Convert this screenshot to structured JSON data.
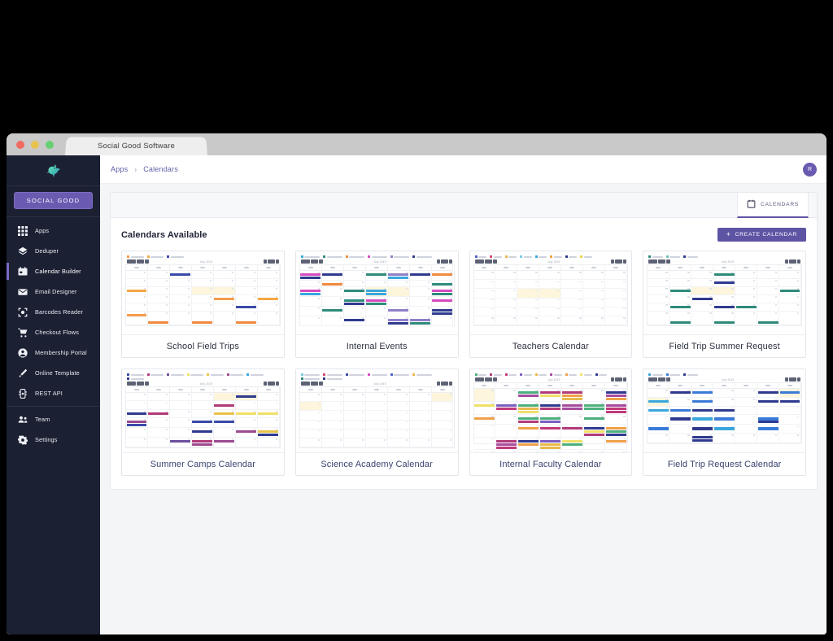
{
  "window": {
    "tab_title": "Social Good Software",
    "traffic_lights": [
      "close",
      "minimize",
      "maximize"
    ]
  },
  "sidebar": {
    "brand_label": "SOCIAL GOOD",
    "logo_icon": "hummingbird-logo",
    "groups": [
      {
        "items": [
          {
            "label": "Apps",
            "icon": "grid-icon",
            "active": false
          },
          {
            "label": "Deduper",
            "icon": "layers-icon",
            "active": false
          },
          {
            "label": "Calendar Builder",
            "icon": "calendar-icon",
            "active": true
          },
          {
            "label": "Email Designer",
            "icon": "envelope-icon",
            "active": false
          },
          {
            "label": "Barcodes Reader",
            "icon": "barcode-scan-icon",
            "active": false
          },
          {
            "label": "Checkout Flows",
            "icon": "shopping-cart-icon",
            "active": false
          },
          {
            "label": "Membership Portal",
            "icon": "user-circle-icon",
            "active": false
          },
          {
            "label": "Online Template",
            "icon": "pen-brush-icon",
            "active": false
          },
          {
            "label": "REST API",
            "icon": "api-plug-icon",
            "active": false
          }
        ]
      },
      {
        "items": [
          {
            "label": "Team",
            "icon": "users-icon",
            "active": false
          },
          {
            "label": "Settings",
            "icon": "gear-icon",
            "active": false
          }
        ]
      }
    ]
  },
  "topbar": {
    "breadcrumb": [
      "Apps",
      "Calendars"
    ],
    "separator": "›",
    "avatar_initial": "R"
  },
  "panel": {
    "tabs": [
      {
        "label": "CALENDARS",
        "icon": "calendar-icon",
        "active": true
      }
    ],
    "title": "Calendars Available",
    "create_button": {
      "label": "CREATE CALENDAR",
      "plus": "+"
    }
  },
  "calendars": [
    {
      "name": "School Field Trips",
      "row": 1,
      "legend_colors": [
        "#f59b4a",
        "#f5a742",
        "#3a4aa8"
      ],
      "accent": "#f08a3c",
      "month_label": "July 2019",
      "density": "low"
    },
    {
      "name": "Internal Events",
      "row": 1,
      "legend_colors": [
        "#3aa6dd",
        "#2e8b7a",
        "#f08a3c",
        "#d64bbf",
        "#8f7fc9",
        "#2f3a8f"
      ],
      "accent": "#2e8b7a",
      "month_label": "July 2019",
      "density": "high"
    },
    {
      "name": "Teachers Calendar",
      "row": 1,
      "legend_colors": [
        "#4c5fc2",
        "#d8456f",
        "#e8b84b",
        "#7ec8e3",
        "#3aa6dd",
        "#f2a03c",
        "#2f3a8f",
        "#e8d44b"
      ],
      "accent": "#9aa3bb",
      "month_label": "July 2019",
      "density": "none"
    },
    {
      "name": "Field Trip Summer Request",
      "row": 1,
      "legend_colors": [
        "#2e8b7a",
        "#6fc0b2",
        "#2f3a8f"
      ],
      "accent": "#2e8b7a",
      "month_label": "July 2019",
      "density": "low"
    },
    {
      "name": "Summer Camps Calendar",
      "row": 2,
      "legend_colors": [
        "#3a4aa8",
        "#b23a7a",
        "#6b4f9e",
        "#efe06a",
        "#e8c24b",
        "#9b4a8f",
        "#3aa6dd",
        "#2f3a8f"
      ],
      "accent": "#8d4b8f",
      "month_label": "July 2019",
      "density": "medium"
    },
    {
      "name": "Science Academy Calendar",
      "row": 2,
      "legend_colors": [
        "#7ec8e3",
        "#d8456f",
        "#3a4aa8",
        "#d64bbf",
        "#4c5fc2",
        "#e8b84b",
        "#2e8b7a",
        "#2f3a8f"
      ],
      "accent": "#9aa3bb",
      "month_label": "July 2019",
      "density": "none"
    },
    {
      "name": "Internal Faculty Calendar",
      "row": 2,
      "legend_colors": [
        "#4caf7d",
        "#b23a7a",
        "#c0397a",
        "#7b5fc0",
        "#e8b84b",
        "#a64b9e",
        "#f0a04b",
        "#efe06a",
        "#2f3a8f"
      ],
      "accent": "#b4477c",
      "month_label": "July 2019",
      "density": "very-high"
    },
    {
      "name": "Field Trip Request Calendar",
      "row": 2,
      "legend_colors": [
        "#3aa6dd",
        "#3a7ad8",
        "#2f3a8f"
      ],
      "accent": "#2f6fd0",
      "month_label": "July 2019",
      "density": "medium"
    }
  ],
  "colors": {
    "brand_purple": "#5e54a4",
    "sidebar_bg": "#1c2033",
    "page_bg": "#f4f5f7",
    "link_blue": "#5f5fa7",
    "row2_label": "#3b4470"
  }
}
